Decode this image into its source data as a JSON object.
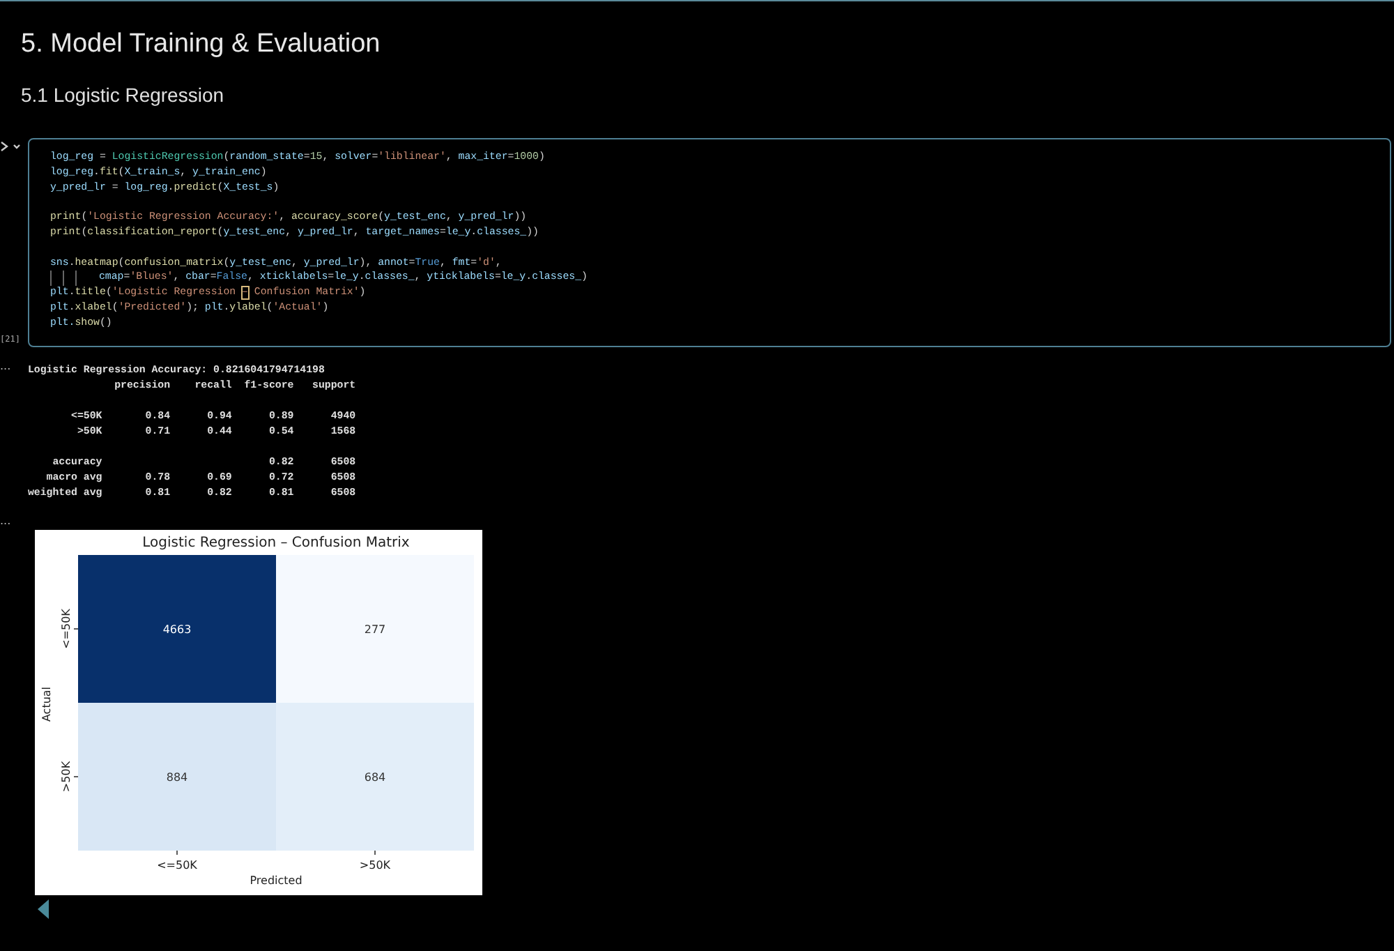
{
  "heading": "5. Model Training & Evaluation",
  "subheading": "5.1 Logistic Regression",
  "cell": {
    "execution_count": "[21]",
    "selected": true,
    "lines": [
      {
        "kind": "code",
        "tokens": [
          {
            "kind": "v",
            "text": "log_reg"
          },
          {
            "kind": "p",
            "text": " = "
          },
          {
            "kind": "c",
            "text": "LogisticRegression"
          },
          {
            "kind": "p",
            "text": "("
          },
          {
            "kind": "v",
            "text": "random_state"
          },
          {
            "kind": "p",
            "text": "="
          },
          {
            "kind": "n",
            "text": "15"
          },
          {
            "kind": "p",
            "text": ", "
          },
          {
            "kind": "v",
            "text": "solver"
          },
          {
            "kind": "p",
            "text": "="
          },
          {
            "kind": "s",
            "text": "'liblinear'"
          },
          {
            "kind": "p",
            "text": ", "
          },
          {
            "kind": "v",
            "text": "max_iter"
          },
          {
            "kind": "p",
            "text": "="
          },
          {
            "kind": "n",
            "text": "1000"
          },
          {
            "kind": "p",
            "text": ")"
          }
        ]
      },
      {
        "kind": "code",
        "tokens": [
          {
            "kind": "v",
            "text": "log_reg"
          },
          {
            "kind": "p",
            "text": "."
          },
          {
            "kind": "f",
            "text": "fit"
          },
          {
            "kind": "p",
            "text": "("
          },
          {
            "kind": "v",
            "text": "X_train_s"
          },
          {
            "kind": "p",
            "text": ", "
          },
          {
            "kind": "v",
            "text": "y_train_enc"
          },
          {
            "kind": "p",
            "text": ")"
          }
        ]
      },
      {
        "kind": "code",
        "tokens": [
          {
            "kind": "v",
            "text": "y_pred_lr"
          },
          {
            "kind": "p",
            "text": " = "
          },
          {
            "kind": "v",
            "text": "log_reg"
          },
          {
            "kind": "p",
            "text": "."
          },
          {
            "kind": "f",
            "text": "predict"
          },
          {
            "kind": "p",
            "text": "("
          },
          {
            "kind": "v",
            "text": "X_test_s"
          },
          {
            "kind": "p",
            "text": ")"
          }
        ]
      },
      {
        "kind": "blank"
      },
      {
        "kind": "code",
        "tokens": [
          {
            "kind": "f",
            "text": "print"
          },
          {
            "kind": "p",
            "text": "("
          },
          {
            "kind": "s",
            "text": "'Logistic Regression Accuracy:'"
          },
          {
            "kind": "p",
            "text": ", "
          },
          {
            "kind": "f",
            "text": "accuracy_score"
          },
          {
            "kind": "p",
            "text": "("
          },
          {
            "kind": "v",
            "text": "y_test_enc"
          },
          {
            "kind": "p",
            "text": ", "
          },
          {
            "kind": "v",
            "text": "y_pred_lr"
          },
          {
            "kind": "p",
            "text": "))"
          }
        ]
      },
      {
        "kind": "code",
        "tokens": [
          {
            "kind": "f",
            "text": "print"
          },
          {
            "kind": "p",
            "text": "("
          },
          {
            "kind": "f",
            "text": "classification_report"
          },
          {
            "kind": "p",
            "text": "("
          },
          {
            "kind": "v",
            "text": "y_test_enc"
          },
          {
            "kind": "p",
            "text": ", "
          },
          {
            "kind": "v",
            "text": "y_pred_lr"
          },
          {
            "kind": "p",
            "text": ", "
          },
          {
            "kind": "v",
            "text": "target_names"
          },
          {
            "kind": "p",
            "text": "="
          },
          {
            "kind": "v",
            "text": "le_y"
          },
          {
            "kind": "p",
            "text": "."
          },
          {
            "kind": "v",
            "text": "classes_"
          },
          {
            "kind": "p",
            "text": "))"
          }
        ]
      },
      {
        "kind": "blank"
      },
      {
        "kind": "code",
        "tokens": [
          {
            "kind": "v",
            "text": "sns"
          },
          {
            "kind": "p",
            "text": "."
          },
          {
            "kind": "f",
            "text": "heatmap"
          },
          {
            "kind": "p",
            "text": "("
          },
          {
            "kind": "f",
            "text": "confusion_matrix"
          },
          {
            "kind": "p",
            "text": "("
          },
          {
            "kind": "v",
            "text": "y_test_enc"
          },
          {
            "kind": "p",
            "text": ", "
          },
          {
            "kind": "v",
            "text": "y_pred_lr"
          },
          {
            "kind": "p",
            "text": "), "
          },
          {
            "kind": "v",
            "text": "annot"
          },
          {
            "kind": "p",
            "text": "="
          },
          {
            "kind": "k",
            "text": "True"
          },
          {
            "kind": "p",
            "text": ", "
          },
          {
            "kind": "v",
            "text": "fmt"
          },
          {
            "kind": "p",
            "text": "="
          },
          {
            "kind": "s",
            "text": "'d'"
          },
          {
            "kind": "p",
            "text": ","
          }
        ]
      },
      {
        "kind": "continuation",
        "tokens": [
          {
            "kind": "v",
            "text": "cmap"
          },
          {
            "kind": "p",
            "text": "="
          },
          {
            "kind": "s",
            "text": "'Blues'"
          },
          {
            "kind": "p",
            "text": ", "
          },
          {
            "kind": "v",
            "text": "cbar"
          },
          {
            "kind": "p",
            "text": "="
          },
          {
            "kind": "k",
            "text": "False"
          },
          {
            "kind": "p",
            "text": ", "
          },
          {
            "kind": "v",
            "text": "xticklabels"
          },
          {
            "kind": "p",
            "text": "="
          },
          {
            "kind": "v",
            "text": "le_y"
          },
          {
            "kind": "p",
            "text": "."
          },
          {
            "kind": "v",
            "text": "classes_"
          },
          {
            "kind": "p",
            "text": ", "
          },
          {
            "kind": "v",
            "text": "yticklabels"
          },
          {
            "kind": "p",
            "text": "="
          },
          {
            "kind": "v",
            "text": "le_y"
          },
          {
            "kind": "p",
            "text": "."
          },
          {
            "kind": "v",
            "text": "classes_"
          },
          {
            "kind": "p",
            "text": ")"
          }
        ]
      },
      {
        "kind": "code",
        "tokens": [
          {
            "kind": "v",
            "text": "plt"
          },
          {
            "kind": "p",
            "text": "."
          },
          {
            "kind": "f",
            "text": "title"
          },
          {
            "kind": "p",
            "text": "("
          },
          {
            "kind": "s",
            "text": "'Logistic Regression "
          },
          {
            "kind": "cursor",
            "text": "–"
          },
          {
            "kind": "s",
            "text": " Confusion Matrix'"
          },
          {
            "kind": "p",
            "text": ")"
          }
        ]
      },
      {
        "kind": "code",
        "tokens": [
          {
            "kind": "v",
            "text": "plt"
          },
          {
            "kind": "p",
            "text": "."
          },
          {
            "kind": "f",
            "text": "xlabel"
          },
          {
            "kind": "p",
            "text": "("
          },
          {
            "kind": "s",
            "text": "'Predicted'"
          },
          {
            "kind": "p",
            "text": "); "
          },
          {
            "kind": "v",
            "text": "plt"
          },
          {
            "kind": "p",
            "text": "."
          },
          {
            "kind": "f",
            "text": "ylabel"
          },
          {
            "kind": "p",
            "text": "("
          },
          {
            "kind": "s",
            "text": "'Actual'"
          },
          {
            "kind": "p",
            "text": ")"
          }
        ]
      },
      {
        "kind": "code",
        "tokens": [
          {
            "kind": "v",
            "text": "plt."
          },
          {
            "kind": "f",
            "text": "show"
          },
          {
            "kind": "p",
            "text": "()"
          }
        ]
      }
    ]
  },
  "outputs": [
    {
      "kind": "text",
      "marker": "...",
      "lines": [
        {
          "kind": "text",
          "text": "Logistic Regression Accuracy: 0.8216041794714198"
        },
        {
          "kind": "text",
          "text": "              precision    recall  f1-score   support"
        },
        {
          "kind": "blank"
        },
        {
          "kind": "text",
          "text": "       <=50K       0.84      0.94      0.89      4940"
        },
        {
          "kind": "text",
          "text": "        >50K       0.71      0.44      0.54      1568"
        },
        {
          "kind": "blank"
        },
        {
          "kind": "text",
          "text": "    accuracy                           0.82      6508"
        },
        {
          "kind": "text",
          "text": "   macro avg       0.78      0.69      0.72      6508"
        },
        {
          "kind": "text",
          "text": "weighted avg       0.81      0.82      0.81      6508"
        }
      ]
    },
    {
      "kind": "figure",
      "marker": "...",
      "figure": {
        "title": "Logistic Regression – Confusion Matrix",
        "xlabel": "Predicted",
        "ylabel": "Actual",
        "xcategories": [
          "<=50K",
          ">50K"
        ],
        "ycategories": [
          "<=50K",
          ">50K"
        ],
        "cells": [
          [
            {
              "value": "4663",
              "color": "#08306b"
            },
            {
              "value": "277",
              "color": "#f5f9fe"
            }
          ],
          [
            {
              "value": "884",
              "color": "#d9e7f5"
            },
            {
              "value": "684",
              "color": "#e3eef9"
            }
          ]
        ]
      }
    }
  ]
}
